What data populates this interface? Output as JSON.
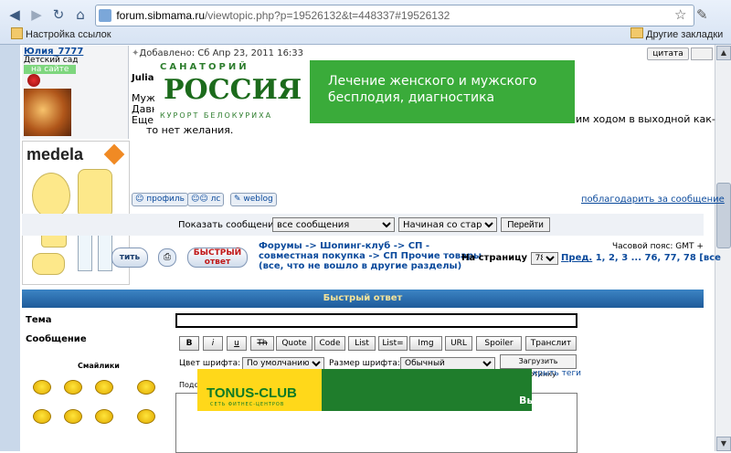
{
  "browser": {
    "address_domain": "forum.sibmama.ru",
    "address_path": "/viewtopic.php?p=19526132&t=448337#19526132",
    "bookmark_left": "Настройка ссылок",
    "bookmark_right": "Другие закладки"
  },
  "post": {
    "username": "Юлия_7777",
    "user_status": "Детский сад",
    "online": "на сайте",
    "meta": "Добавлено: Сб Апр 23, 2011 16:33",
    "quote_label": "цитата",
    "author_short": "Julia",
    "line1": "Муж",
    "line2": "Давн",
    "line3": "Еще",
    "line3_tail": "им ходом в выходной как-",
    "line4": "то нет желания.",
    "profile_btn": "профиль",
    "pm_btn": "лс",
    "weblog_btn": "weblog",
    "thanks": "поблагодарить за сообщение"
  },
  "ad_top": {
    "small1": "САНАТОРИЙ",
    "name": "РОССИЯ",
    "small2": "КУРОРТ БЕЛОКУРИХА",
    "slogan": "Лечение женского и мужского бесплодия, диагностика"
  },
  "ad_side": {
    "brand": "medela"
  },
  "show": {
    "label": "Показать сообщения:",
    "filter": "все сообщения",
    "order": "Начиная со старых",
    "go": "Перейти"
  },
  "nav": {
    "reply_btn": "тить",
    "quick_btn_line1": "БЫСТРЫЙ",
    "quick_btn_line2": "ответ",
    "crumb1": "Форумы -> Шопинг-клуб -> СП -",
    "crumb2": "совместная покупка -> СП Прочие товары",
    "crumb3": "(все, что не вошло в другие разделы)",
    "page_label": "На страницу",
    "page_value": "78",
    "prev": "Пред.",
    "pages": "1, 2, 3 ... 76, 77, 78 [все",
    "tz": "Часовой пояс: GMT +"
  },
  "quick": {
    "header": "Быстрый ответ",
    "topic_label": "Тема",
    "message_label": "Сообщение",
    "smiles_label": "Смайлики",
    "buttons": [
      "B",
      "i",
      "u",
      "Th",
      "Quote",
      "Code",
      "List",
      "List=",
      "Img",
      "URL",
      "Spoiler",
      "Транслит"
    ],
    "color_label": "Цвет шрифта:",
    "color_value": "По умолчанию",
    "size_label": "Размер шрифта:",
    "size_value": "Обычный",
    "upload_btn": "Загрузить картинку",
    "close_tags": "крыть теги",
    "hint": "Подс"
  },
  "ad_bottom": {
    "logo": "TONUS-CLUB",
    "logo_sub": "СЕТЬ ФИТНЕС-ЦЕНТРОВ",
    "tail": "Вы"
  }
}
